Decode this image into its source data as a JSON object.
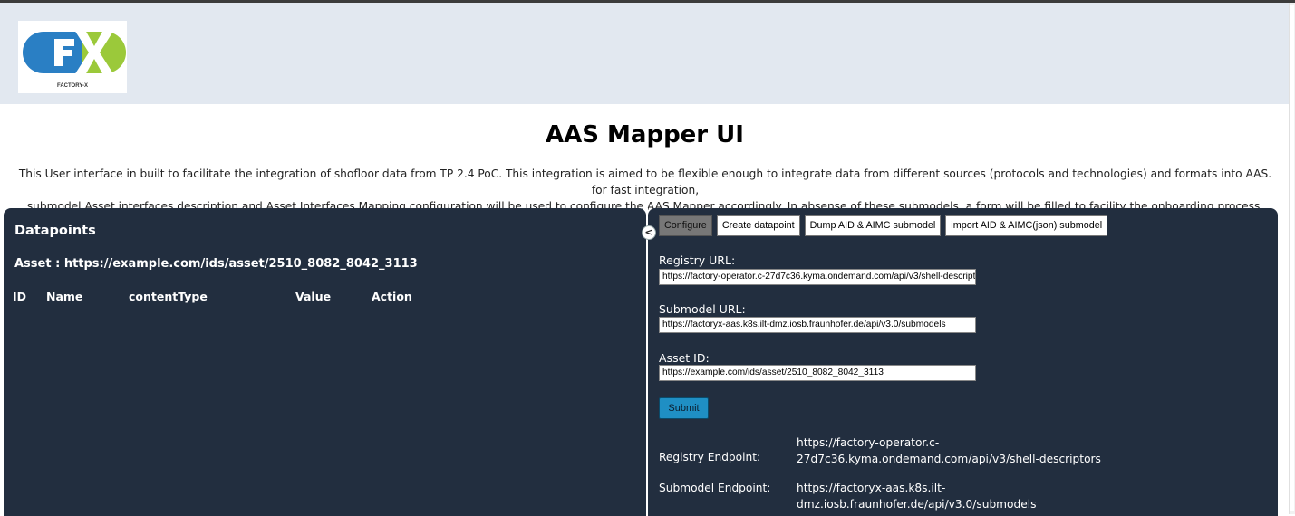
{
  "header": {
    "logo_text": "FACTORY-X",
    "logo_letters": "FX"
  },
  "page": {
    "title": "AAS Mapper UI",
    "intro_line1": "This User interface in built to facilitate the integration of shofloor data from TP 2.4 PoC. This integration is aimed to be flexible enough to integrate data from different sources (protocols and technologies) and formats into AAS. for fast integration,",
    "intro_line2": "submodel Asset interfaces description and Asset Interfaces Mapping configuration will be used to configure the AAS Mapper accordingly. In absense of these submodels, a form will be filled to facility the onboarding process."
  },
  "datapoints": {
    "title": "Datapoints",
    "asset_label": "Asset : https://example.com/ids/asset/2510_8082_8042_3113",
    "columns": [
      "ID",
      "Name",
      "contentType",
      "Value",
      "Action"
    ],
    "collapse_glyph": "<"
  },
  "tabs": [
    {
      "label": "Configure",
      "active": true
    },
    {
      "label": "Create datapoint",
      "active": false
    },
    {
      "label": "Dump AID & AIMC submodel",
      "active": false
    },
    {
      "label": "import AID & AIMC(json) submodel",
      "active": false
    }
  ],
  "form": {
    "registry_label": "Registry URL:",
    "registry_value": "https://factory-operator.c-27d7c36.kyma.ondemand.com/api/v3/shell-descriptors",
    "submodel_label": "Submodel URL:",
    "submodel_value": "https://factoryx-aas.k8s.ilt-dmz.iosb.fraunhofer.de/api/v3.0/submodels",
    "asset_label": "Asset ID:",
    "asset_value": "https://example.com/ids/asset/2510_8082_8042_3113",
    "submit_label": "Submit"
  },
  "endpoints": {
    "registry_label": "Registry Endpoint:",
    "registry_value": "https://factory-operator.c-27d7c36.kyma.ondemand.com/api/v3/shell-descriptors",
    "submodel_label": "Submodel Endpoint:",
    "submodel_value": "https://factoryx-aas.k8s.ilt-dmz.iosb.fraunhofer.de/api/v3.0/submodels"
  },
  "colors": {
    "header_bg": "#e2e8f0",
    "panel_bg": "#222e3f",
    "submit_bg": "#1f8fc4",
    "logo_blue": "#2a7fc4",
    "logo_green": "#9bc93a"
  }
}
